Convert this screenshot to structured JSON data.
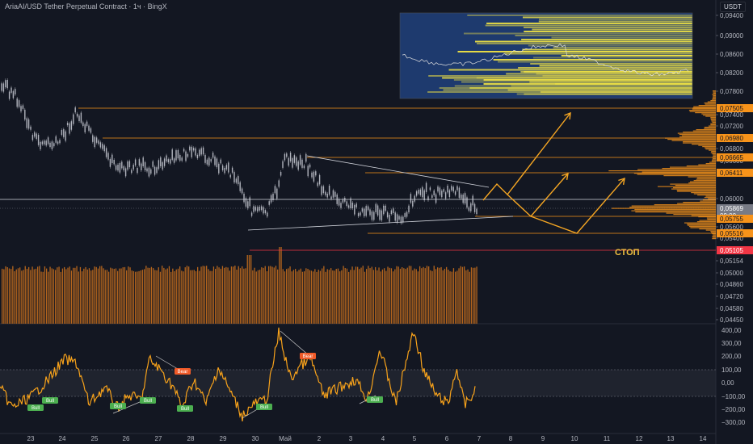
{
  "header": {
    "title": "AriaAI/USD Tether Perpetual Contract · 1ч · BingX",
    "quote_currency": "USDT"
  },
  "price_axis": {
    "labels": [
      "0,09400",
      "0,09000",
      "0,08600",
      "0,08200",
      "0,07800",
      "0,07400",
      "0,07200",
      "0,06800",
      "0,06600",
      "0,06000",
      "0,05600",
      "0,05400",
      "0,05154",
      "0,05000",
      "0,04860",
      "0,04720",
      "0,04580",
      "0,04450"
    ]
  },
  "price_tags": [
    {
      "label": "0,07505",
      "kind": "orange"
    },
    {
      "label": "0,06980",
      "kind": "orange"
    },
    {
      "label": "0,06665",
      "kind": "orange"
    },
    {
      "label": "0,06411",
      "kind": "orange"
    },
    {
      "label": "0,05869",
      "kind": "current"
    },
    {
      "label": "09:00",
      "kind": "timer"
    },
    {
      "label": "0,05755",
      "kind": "orange"
    },
    {
      "label": "0,05516",
      "kind": "orange"
    },
    {
      "label": "0,05105",
      "kind": "red"
    }
  ],
  "osc_axis": {
    "labels": [
      "400,00",
      "300,00",
      "200,00",
      "100,00",
      "0,00",
      "−100,00",
      "−200,00",
      "−300,00"
    ]
  },
  "time_axis": {
    "labels": [
      "23",
      "24",
      "25",
      "26",
      "27",
      "28",
      "29",
      "30",
      "Май",
      "2",
      "3",
      "4",
      "5",
      "6",
      "7",
      "8",
      "9",
      "10",
      "11",
      "12",
      "13",
      "14"
    ]
  },
  "annotations": {
    "stop_label": "СТОП"
  },
  "signals": [
    "Bull",
    "Bull",
    "Bull",
    "Bull",
    "Bull",
    "Bull",
    "Bull",
    "Bear",
    "Bear"
  ],
  "colors": {
    "background": "#131722",
    "orange": "#f7931a",
    "bull": "#4caf50",
    "bear": "#f05a28",
    "stop_line": "#f23645",
    "volume": "#b5651d",
    "heatmap_yellow": "#f5e642",
    "heatmap_blue": "#1e3a6e"
  }
}
